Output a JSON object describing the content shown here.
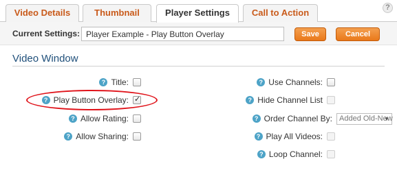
{
  "tabs": [
    {
      "label": "Video Details",
      "active": false
    },
    {
      "label": "Thumbnail",
      "active": false
    },
    {
      "label": "Player Settings",
      "active": true
    },
    {
      "label": "Call to Action",
      "active": false
    }
  ],
  "help_icon_glyph": "?",
  "current_settings": {
    "label": "Current Settings:",
    "value": "Player Example - Play Button Overlay"
  },
  "buttons": {
    "save_label": "Save",
    "cancel_label": "Cancel"
  },
  "section_title": "Video Window",
  "left_fields": [
    {
      "label": "Title:",
      "checked": false
    },
    {
      "label": "Play Button Overlay:",
      "checked": true
    },
    {
      "label": "Allow Rating:",
      "checked": false
    },
    {
      "label": "Allow Sharing:",
      "checked": false
    }
  ],
  "right_fields": [
    {
      "label": "Use Channels:",
      "checked": false,
      "disabled": false
    },
    {
      "label": "Hide Channel List",
      "checked": false,
      "disabled": true
    },
    {
      "label": "Order Channel By:",
      "select_value": "Added Old-New"
    },
    {
      "label": "Play All Videos:",
      "checked": false,
      "disabled": true
    },
    {
      "label": "Loop Channel:",
      "checked": false,
      "disabled": true
    }
  ],
  "colors": {
    "accent_orange": "#e9781a",
    "tab_text": "#c95a1a",
    "section_title": "#1f4f7a",
    "annotation_red": "#e0141b",
    "help_blue": "#4da3c7"
  }
}
